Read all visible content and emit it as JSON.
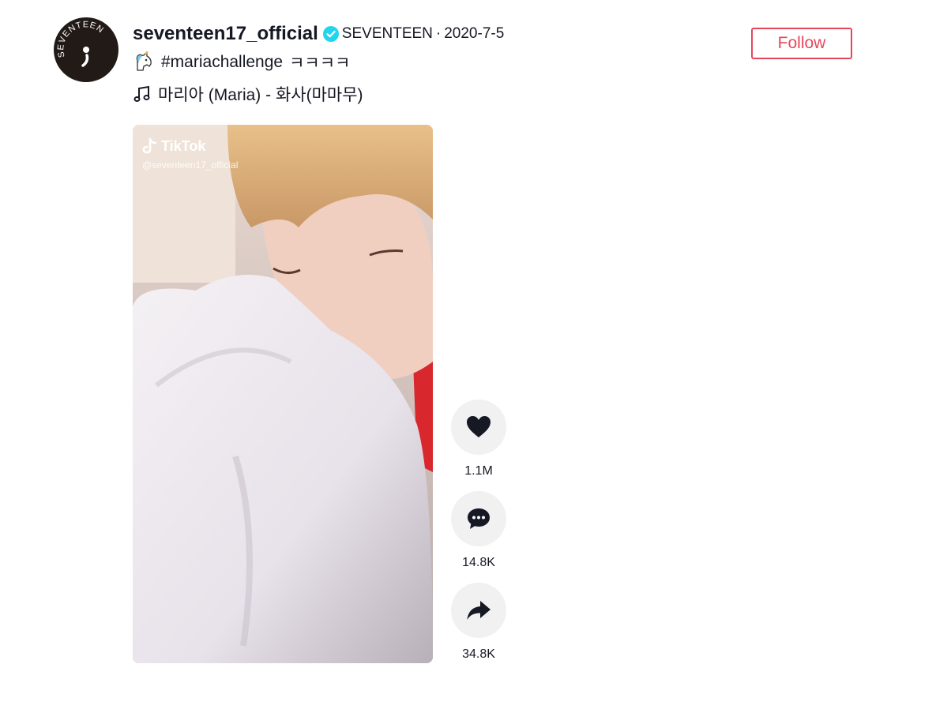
{
  "post": {
    "username": "seventeen17_official",
    "nickname": "SEVENTEEN",
    "separator": "·",
    "date": "2020-7-5",
    "follow_label": "Follow",
    "avatar_text": "SEVENTEEN",
    "caption_emoji_icon": "unicorn-icon",
    "hashtag": "#mariachallenge",
    "caption_extra": "ㅋㅋㅋㅋ",
    "music": "마리아 (Maria) - 화사(마마무)"
  },
  "video": {
    "watermark_brand": "TikTok",
    "watermark_user": "@seventeen17_official"
  },
  "actions": [
    {
      "icon": "heart-icon",
      "count": "1.1M"
    },
    {
      "icon": "comment-icon",
      "count": "14.8K"
    },
    {
      "icon": "share-icon",
      "count": "34.8K"
    }
  ],
  "colors": {
    "follow": "#e5475a",
    "verified": "#20d5ec",
    "text": "#161823",
    "action_bg": "#f1f1f2"
  }
}
